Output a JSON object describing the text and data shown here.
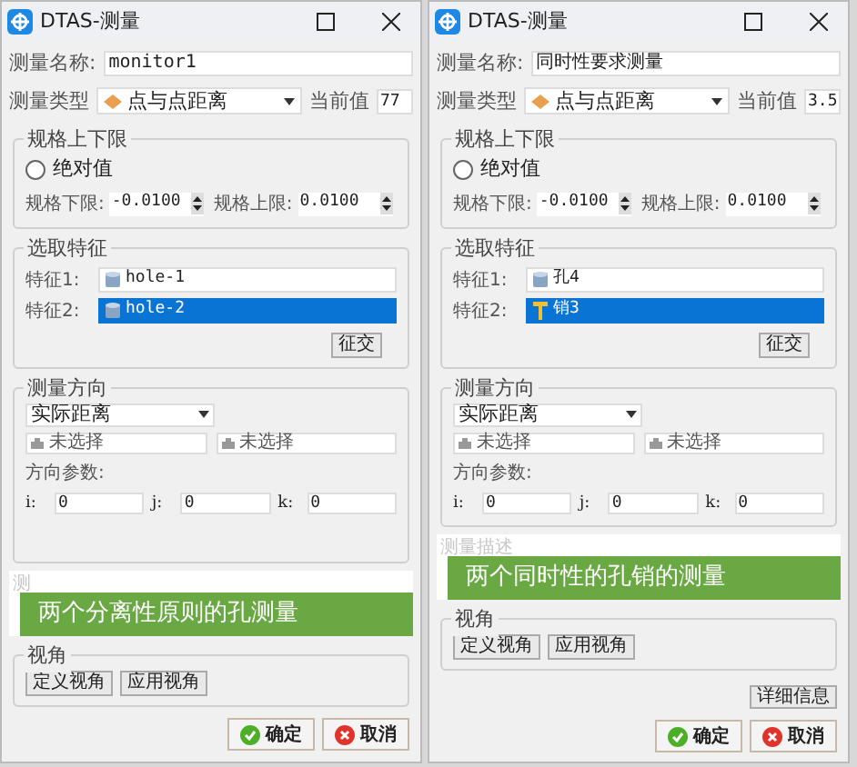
{
  "windows": [
    {
      "title": "DTAS-测量",
      "name_label": "测量名称:",
      "name_value": "monitor1",
      "type_label": "测量类型",
      "type_value": "点与点距离",
      "current_label": "当前值",
      "current_value": "77",
      "limits": {
        "title": "规格上下限",
        "absolute_label": "绝对值",
        "absolute_checked": false,
        "lower_label": "规格下限:",
        "lower_value": "-0.0100",
        "upper_label": "规格上限:",
        "upper_value": "0.0100"
      },
      "features": {
        "title": "选取特征",
        "items": [
          {
            "label": "特征1:",
            "value": "hole-1",
            "kind": "hole",
            "selected": false
          },
          {
            "label": "特征2:",
            "value": "hole-2",
            "kind": "hole",
            "selected": true
          }
        ],
        "swap_button": "征交"
      },
      "direction": {
        "title": "测量方向",
        "mode": "实际距离",
        "selectors": [
          "未选择",
          "未选择"
        ],
        "params_label": "方向参数:",
        "params": [
          {
            "label": "i:",
            "value": "0"
          },
          {
            "label": "j:",
            "value": "0"
          },
          {
            "label": "k:",
            "value": "0"
          }
        ]
      },
      "description": {
        "placeholder": "测"
      },
      "caption": "两个分离性原则的孔测量",
      "view": {
        "title": "视角",
        "buttons": [
          "定义视角",
          "应用视角"
        ]
      },
      "ok": "确定",
      "cancel": "取消"
    },
    {
      "title": "DTAS-测量",
      "name_label": "测量名称:",
      "name_value": "同时性要求测量",
      "type_label": "测量类型",
      "type_value": "点与点距离",
      "current_label": "当前值",
      "current_value": "3.5",
      "limits": {
        "title": "规格上下限",
        "absolute_label": "绝对值",
        "absolute_checked": false,
        "lower_label": "规格下限:",
        "lower_value": "-0.0100",
        "upper_label": "规格上限:",
        "upper_value": "0.0100"
      },
      "features": {
        "title": "选取特征",
        "items": [
          {
            "label": "特征1:",
            "value": "孔4",
            "kind": "hole",
            "selected": false
          },
          {
            "label": "特征2:",
            "value": "销3",
            "kind": "pin",
            "selected": true
          }
        ],
        "swap_button": "征交"
      },
      "direction": {
        "title": "测量方向",
        "mode": "实际距离",
        "selectors": [
          "未选择",
          "未选择"
        ],
        "params_label": "方向参数:",
        "params": [
          {
            "label": "i:",
            "value": "0"
          },
          {
            "label": "j:",
            "value": "0"
          },
          {
            "label": "k:",
            "value": "0"
          }
        ]
      },
      "description": {
        "placeholder": "测量描述"
      },
      "caption": "两个同时性的孔销的测量",
      "view": {
        "title": "视角",
        "buttons": [
          "定义视角",
          "应用视角"
        ]
      },
      "detail_button": "详细信息",
      "ok": "确定",
      "cancel": "取消"
    }
  ]
}
